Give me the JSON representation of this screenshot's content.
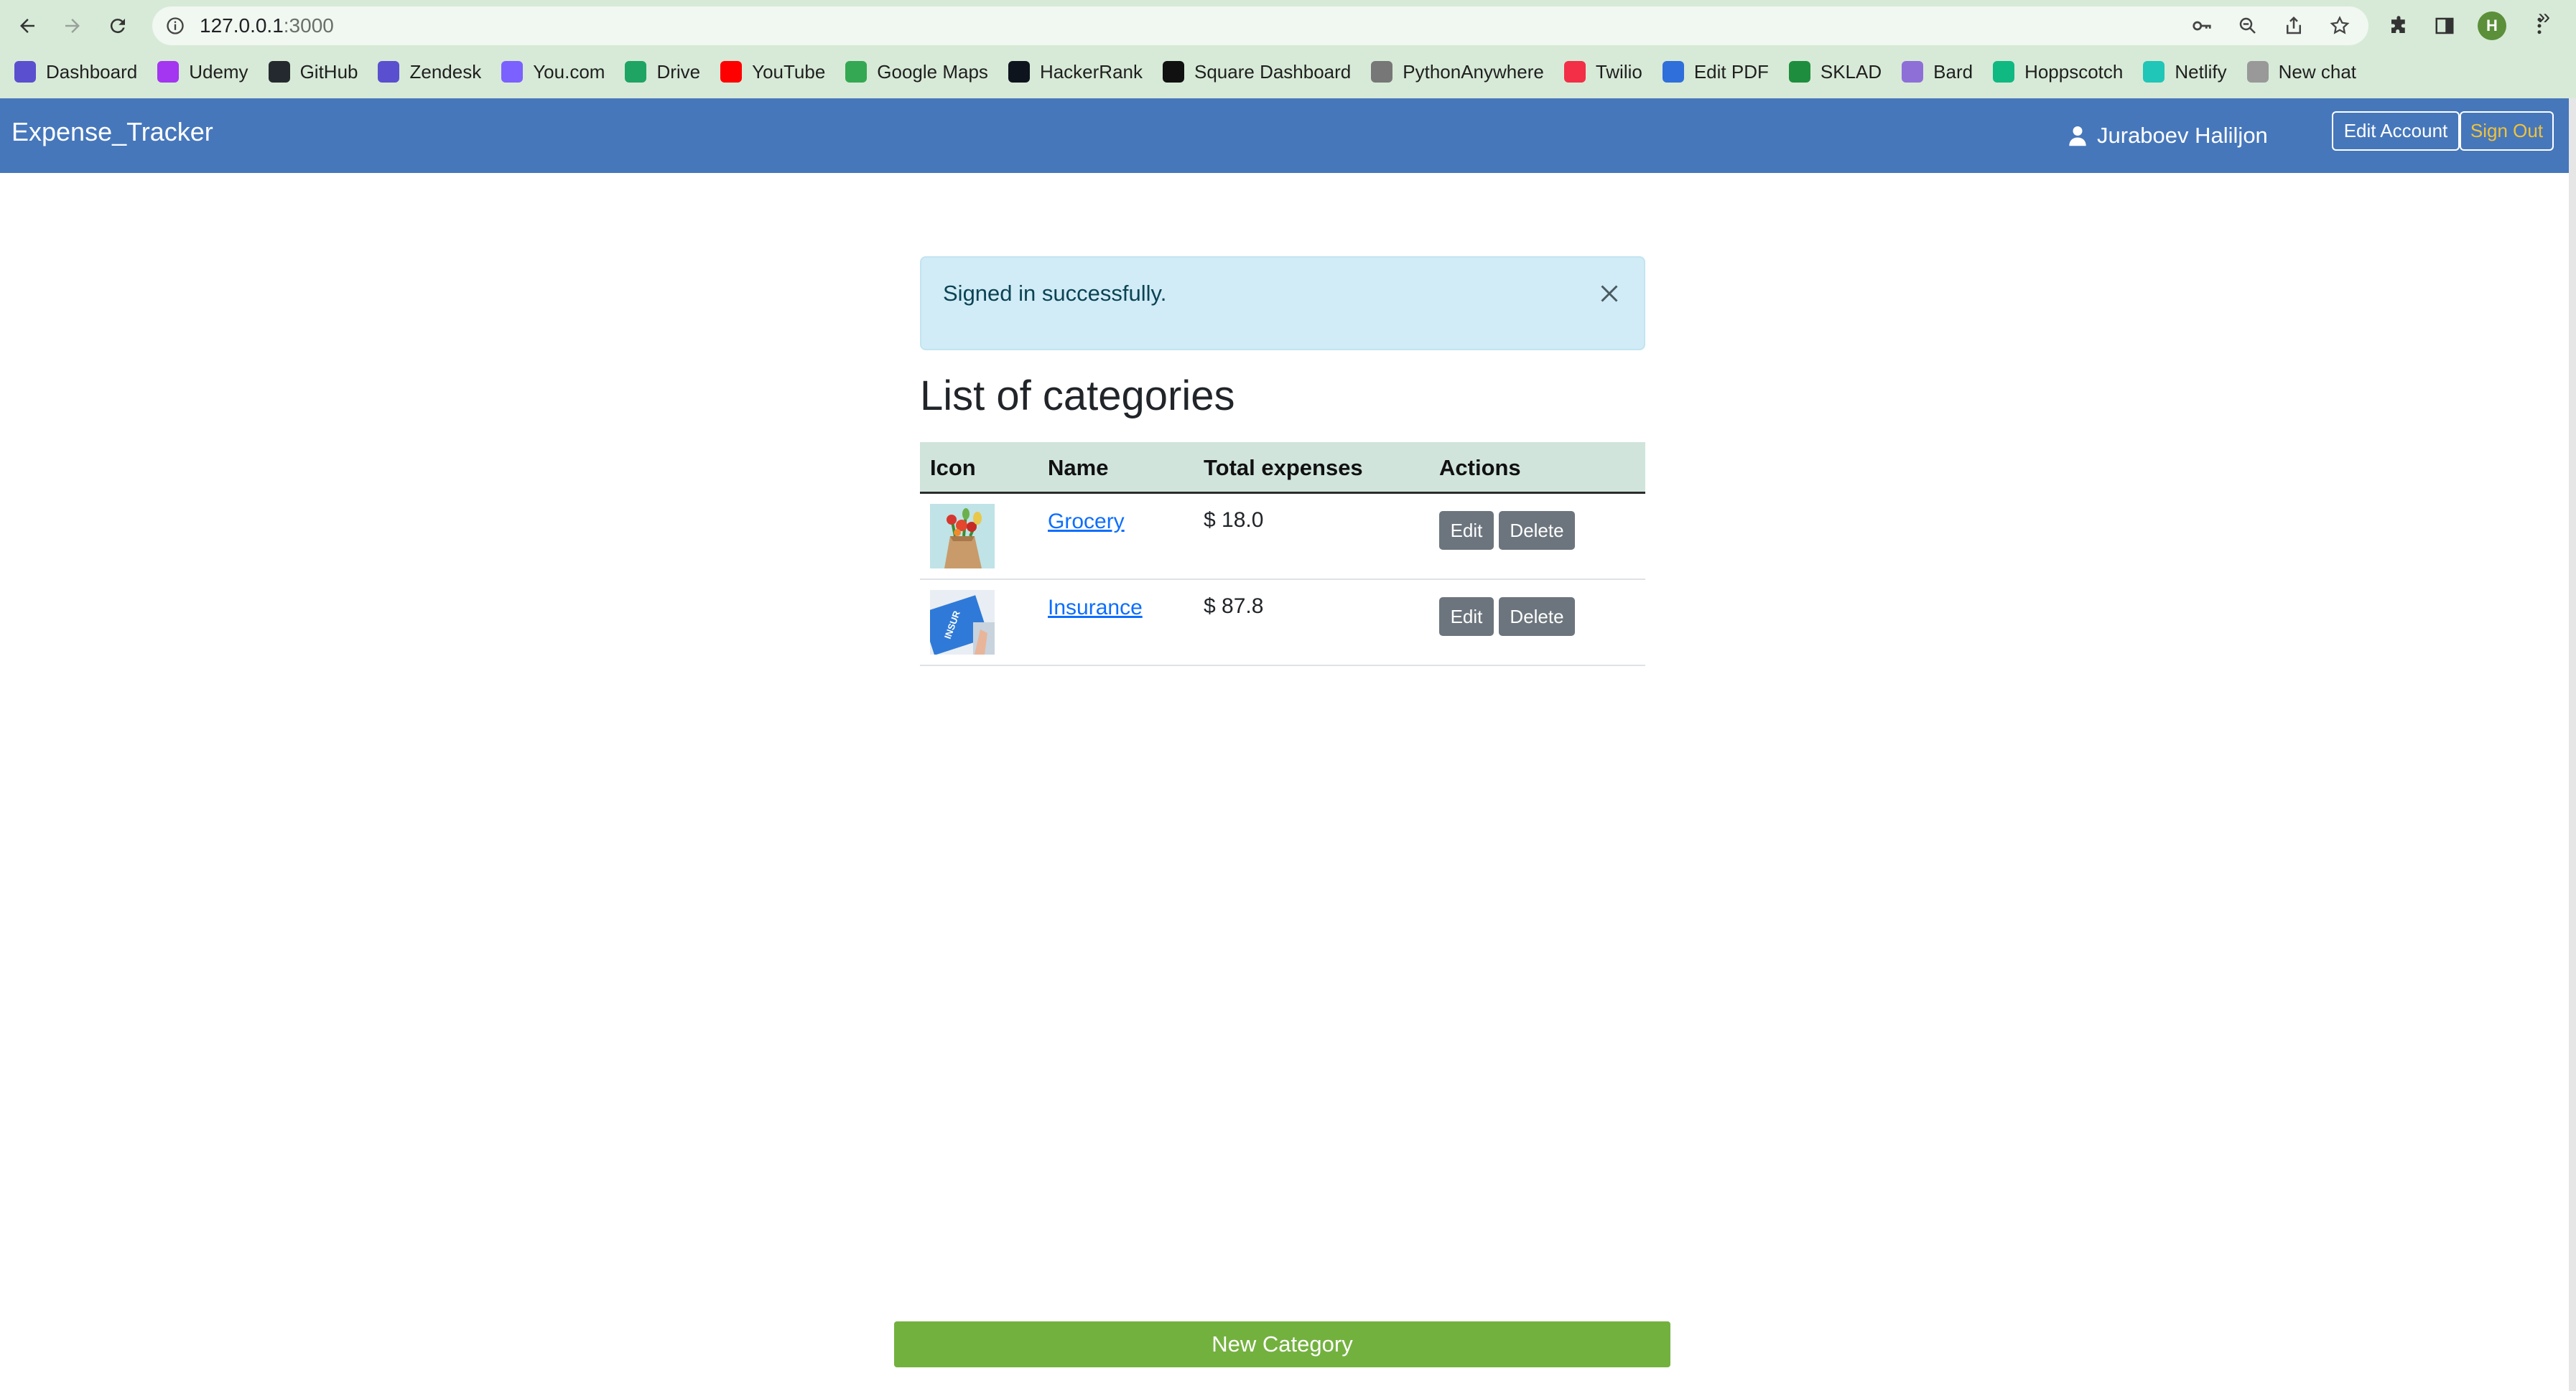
{
  "browser": {
    "url_host": "127.0.0.1",
    "url_port": ":3000",
    "avatar_letter": "H",
    "bookmarks": [
      {
        "label": "Dashboard",
        "color": "#5a4fcf"
      },
      {
        "label": "Udemy",
        "color": "#a435f0"
      },
      {
        "label": "GitHub",
        "color": "#24292f"
      },
      {
        "label": "Zendesk",
        "color": "#5a4fcf"
      },
      {
        "label": "You.com",
        "color": "#7b61ff"
      },
      {
        "label": "Drive",
        "color": "#1fa463"
      },
      {
        "label": "YouTube",
        "color": "#ff0000"
      },
      {
        "label": "Google Maps",
        "color": "#34a853"
      },
      {
        "label": "HackerRank",
        "color": "#0e141e"
      },
      {
        "label": "Square Dashboard",
        "color": "#111111"
      },
      {
        "label": "PythonAnywhere",
        "color": "#777777"
      },
      {
        "label": "Twilio",
        "color": "#f22f46"
      },
      {
        "label": "Edit PDF",
        "color": "#2f6fdb"
      },
      {
        "label": "SKLAD",
        "color": "#1e8e3e"
      },
      {
        "label": "Bard",
        "color": "#8e6fd8"
      },
      {
        "label": "Hoppscotch",
        "color": "#10b981"
      },
      {
        "label": "Netlify",
        "color": "#20c6b7"
      },
      {
        "label": "New chat",
        "color": "#999999"
      }
    ],
    "more_bookmarks": "»"
  },
  "app": {
    "brand": "Expense_Tracker",
    "user_name": "Juraboev Haliljon",
    "edit_account": "Edit Account",
    "sign_out": "Sign Out",
    "colors": {
      "navbar": "#4677bb",
      "sign_out": "#f0c23b",
      "new_category": "#73b13f",
      "alert_bg": "#d1ecf6"
    }
  },
  "alert": {
    "message": "Signed in successfully."
  },
  "page": {
    "title": "List of categories"
  },
  "table": {
    "headers": {
      "icon": "Icon",
      "name": "Name",
      "total": "Total expenses",
      "actions": "Actions"
    },
    "rows": [
      {
        "name": "Grocery",
        "total": "$ 18.0",
        "icon": "grocery-image",
        "edit": "Edit",
        "delete": "Delete"
      },
      {
        "name": "Insurance",
        "total": "$ 87.8",
        "icon": "insurance-image",
        "edit": "Edit",
        "delete": "Delete"
      }
    ]
  },
  "footer": {
    "new_category": "New Category"
  }
}
